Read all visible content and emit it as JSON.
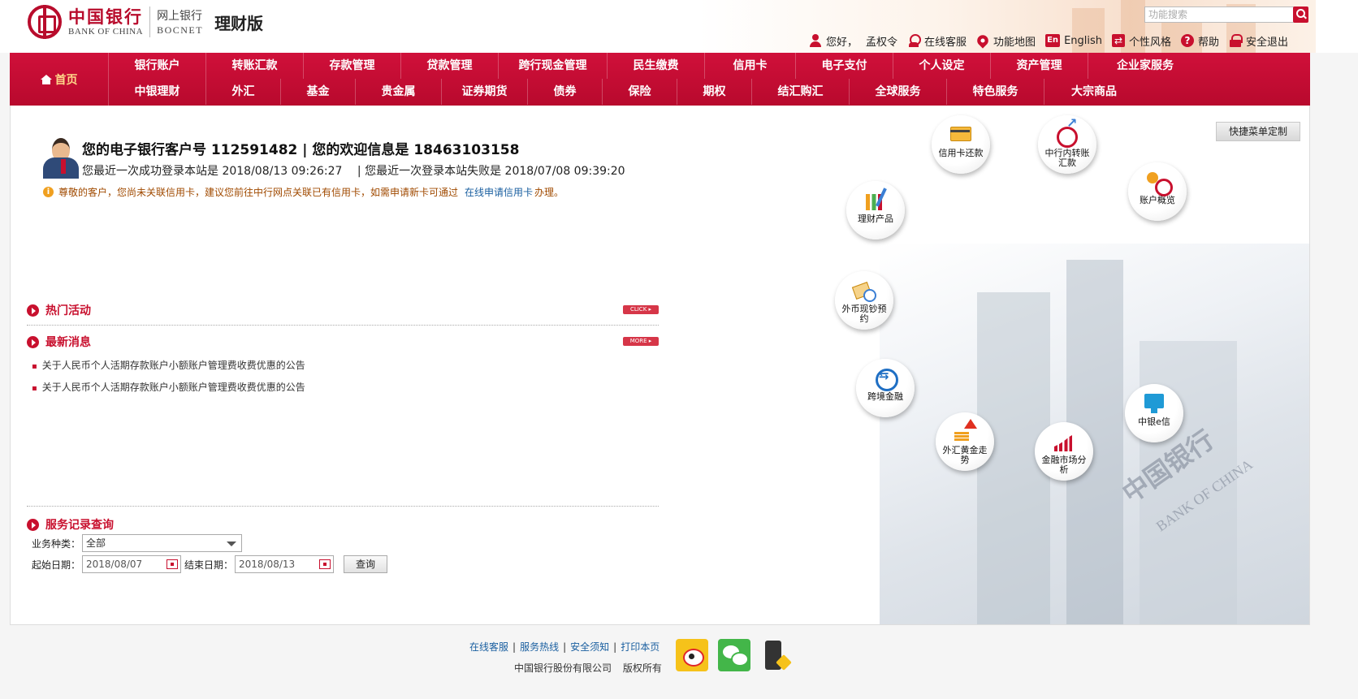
{
  "header": {
    "logo_cn": "中国银行",
    "logo_en": "BANK OF CHINA",
    "bocnet_cn": "网上银行",
    "bocnet_en": "BOCNET",
    "version": "理财版",
    "search_placeholder": "功能搜索",
    "greeting": "您好，",
    "user_name": "孟权令",
    "links": {
      "online_service": "在线客服",
      "function_map": "功能地图",
      "english": "English",
      "style": "个性风格",
      "help": "帮助",
      "logout": "安全退出"
    },
    "icons": {
      "english": "En",
      "style": "⇄",
      "help": "?"
    }
  },
  "nav": {
    "home": "首页",
    "row1": [
      "银行账户",
      "转账汇款",
      "存款管理",
      "贷款管理",
      "跨行现金管理",
      "民生缴费",
      "信用卡",
      "电子支付",
      "个人设定",
      "资产管理",
      "企业家服务"
    ],
    "row2": [
      "中银理财",
      "外汇",
      "基金",
      "贵金属",
      "证券期货",
      "债券",
      "保险",
      "期权",
      "结汇购汇",
      "全球服务",
      "特色服务",
      "大宗商品"
    ]
  },
  "welcome": {
    "line1": "您的电子银行客户号 112591482 | 您的欢迎信息是  18463103158",
    "last_success": "您最近一次成功登录本站是 2018/08/13 09:26:27",
    "last_fail": "| 您最近一次登录本站失败是 2018/07/08 09:39:20",
    "notice_icon": "i",
    "notice_text": "尊敬的客户，您尚未关联信用卡，建议您前往中行网点关联已有信用卡，如需申请新卡可通过",
    "notice_link": "在线申请信用卡",
    "notice_end": "办理。"
  },
  "sections": {
    "hot": {
      "title": "热门活动",
      "more": "CLICK ▸"
    },
    "news": {
      "title": "最新消息",
      "more": "MORE ▸",
      "items": [
        "关于人民币个人活期存款账户小额账户管理费收费优惠的公告",
        "关于人民币个人活期存款账户小额账户管理费收费优惠的公告"
      ]
    },
    "service": {
      "title": "服务记录查询",
      "type_label": "业务种类：",
      "type_value": "全部",
      "start_label": "起始日期：",
      "start_value": "2018/08/07",
      "end_label": "结束日期：",
      "end_value": "2018/08/13",
      "query_button": "查询"
    }
  },
  "quick_menu": {
    "customize": "快捷菜单定制",
    "items": [
      "信用卡还款",
      "中行内转账汇款",
      "账户概览",
      "理财产品",
      "外币现钞预约",
      "跨境金融",
      "中银e信",
      "外汇黄金走势",
      "金融市场分析"
    ]
  },
  "background": {
    "brand_cn": "中国银行",
    "brand_en": "BANK OF CHINA"
  },
  "footer": {
    "links": [
      "在线客服",
      "服务热线",
      "安全须知",
      "打印本页"
    ],
    "separator": "|",
    "company": "中国银行股份有限公司",
    "rights": "版权所有"
  },
  "colors": {
    "brand_red": "#c8102e",
    "link_blue": "#1a5fa0",
    "nav_home_text": "#ffd98a"
  }
}
